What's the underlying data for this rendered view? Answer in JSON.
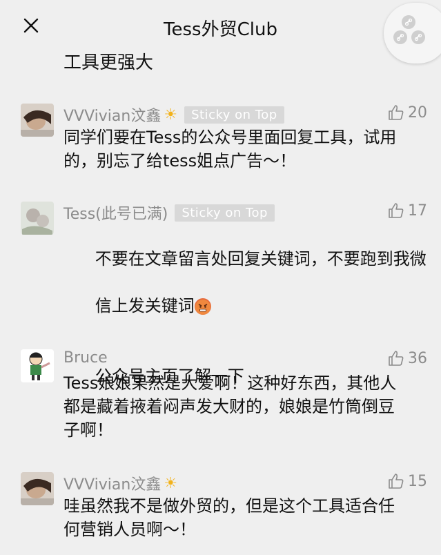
{
  "header": {
    "title": "Tess外贸Club",
    "close_icon": "close-icon",
    "mini_program_icon": "link-chain-icon"
  },
  "partial_text": "工具更强大",
  "comments": [
    {
      "name": "VVVivian汶鑫",
      "name_icon": "sun-icon",
      "badge": "Sticky on Top",
      "likes": "20",
      "text": "同学们要在Tess的公众号里面回复工具，试用\n的，别忘了给tess姐点广告～！"
    },
    {
      "name": "Tess(此号已满)",
      "badge": "Sticky on Top",
      "likes": "17",
      "text_lines": [
        "不要在文章留言处回复关键词，不要跑到我微",
        "信上发关键词"
      ],
      "text_emoji": "angry-face-emoji",
      "text_after": "公众号主页了解一下"
    },
    {
      "name": "Bruce",
      "likes": "36",
      "text": "Tess娘娘果然是大爱啊！这种好东西，其他人\n都是藏着掖着闷声发大财的，娘娘是竹筒倒豆\n子啊！"
    },
    {
      "name": "VVVivian汶鑫",
      "name_icon": "sun-icon",
      "likes": "15",
      "text": "哇虽然我不是做外贸的，但是这个工具适合任\n何营销人员啊～！"
    }
  ]
}
